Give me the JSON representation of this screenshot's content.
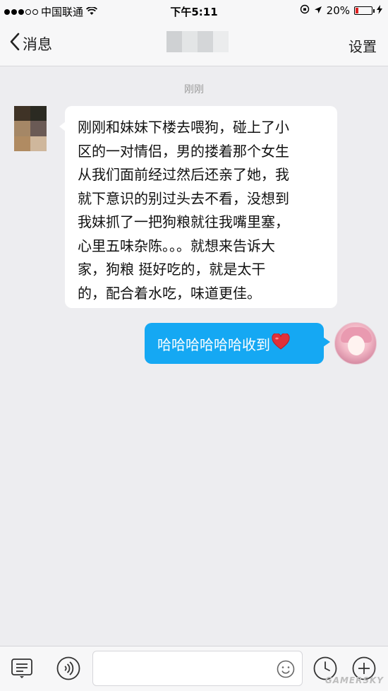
{
  "status_bar": {
    "carrier": "中国联通",
    "time": "下午5:11",
    "battery": "20%",
    "battery_level": 0.2,
    "battery_color": "#e02020"
  },
  "nav": {
    "back_label": "消息",
    "settings_label": "设置",
    "title_blur_colors": [
      "#cfd1d3",
      "#e3e5e6",
      "#d4d6d8",
      "#ebeced"
    ]
  },
  "chat": {
    "timestamp": "刚刚",
    "incoming_avatar_colors": [
      "#3f3326",
      "#2b2a22",
      "#a58766",
      "#6a5a55",
      "#b08b62",
      "#cfb79c"
    ],
    "incoming_lines": [
      "刚刚和妹妹下楼去喂狗，碰上了小",
      "区的一对情侣，男的搂着那个女生",
      "从我们面前经过然后还亲了她，我",
      "就下意识的别过头去不看，没想到",
      "我妹抓了一把狗粮就往我嘴里塞，",
      "心里五味杂陈。。。就想来告诉大",
      "家，狗粮 挺好吃的，就是太干",
      "的，配合着水吃，味道更佳。"
    ],
    "outgoing_text": "哈哈哈哈哈哈收到",
    "outgoing_emoji": "heart-icon",
    "outgoing_bubble_color": "#15a8f3"
  },
  "input_bar": {
    "placeholder": ""
  },
  "watermark": "GAMERSKY"
}
